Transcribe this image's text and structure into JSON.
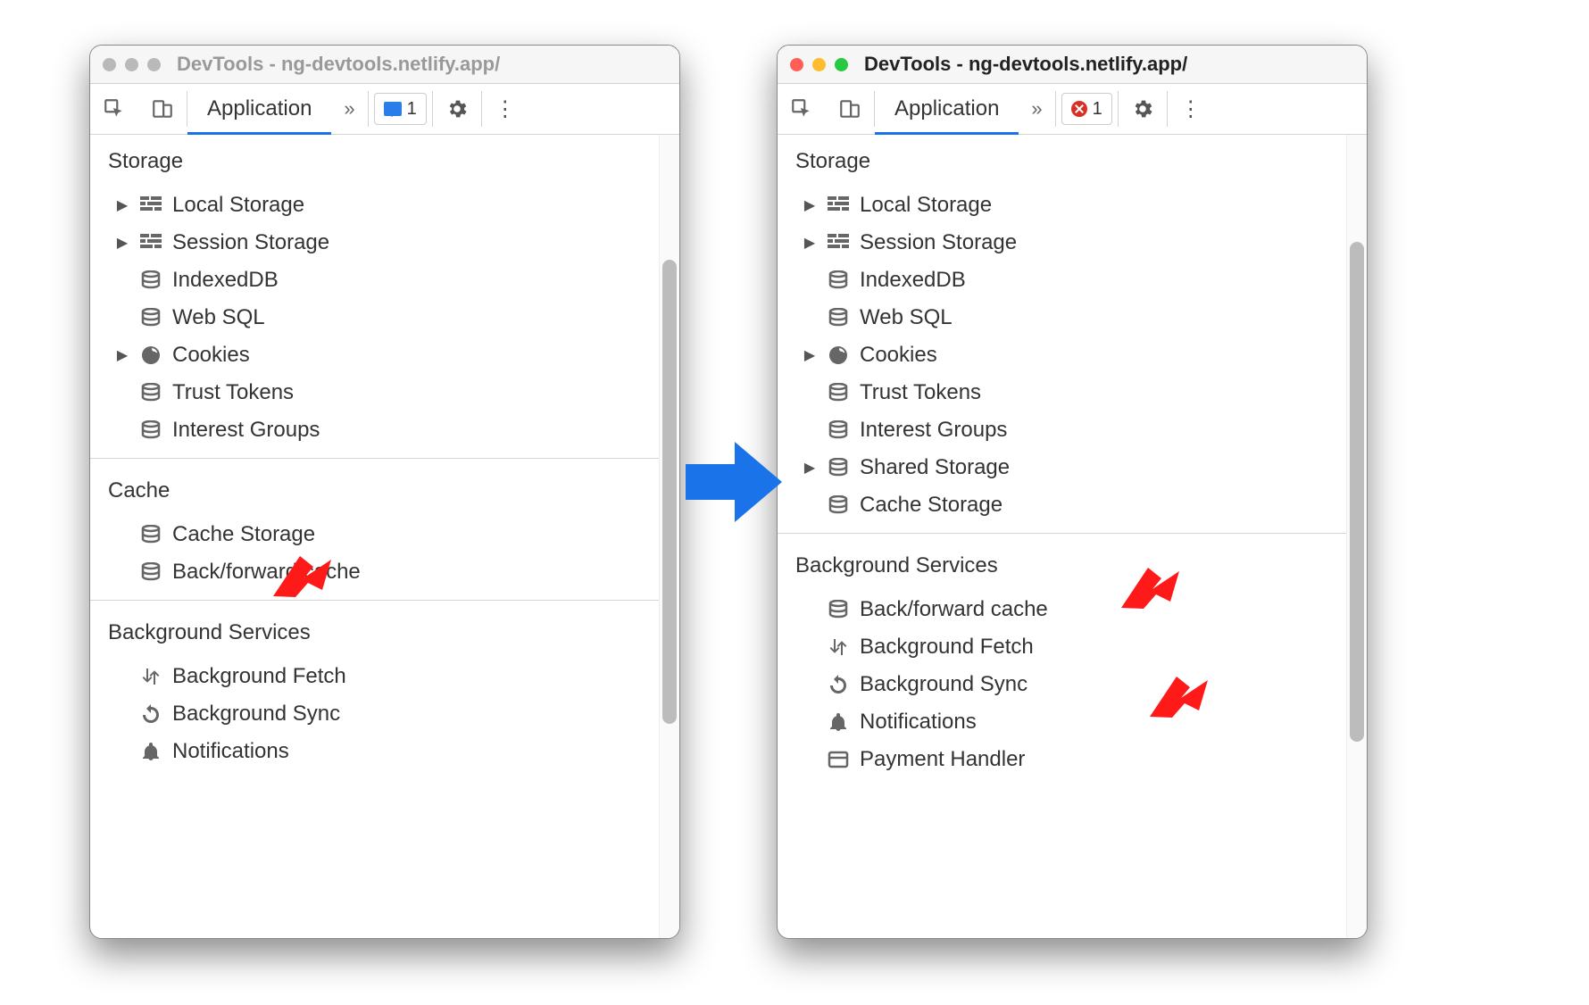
{
  "windows": {
    "left": {
      "title": "DevTools - ng-devtools.netlify.app/",
      "active": false,
      "toolbar": {
        "tab_label": "Application",
        "badge_count": "1",
        "badge_type": "message"
      },
      "sections": [
        {
          "title": "Storage",
          "items": [
            {
              "label": "Local Storage",
              "icon": "grid",
              "expandable": true
            },
            {
              "label": "Session Storage",
              "icon": "grid",
              "expandable": true
            },
            {
              "label": "IndexedDB",
              "icon": "db",
              "expandable": false
            },
            {
              "label": "Web SQL",
              "icon": "db",
              "expandable": false
            },
            {
              "label": "Cookies",
              "icon": "cookie",
              "expandable": true
            },
            {
              "label": "Trust Tokens",
              "icon": "db",
              "expandable": false
            },
            {
              "label": "Interest Groups",
              "icon": "db",
              "expandable": false
            }
          ]
        },
        {
          "title": "Cache",
          "items": [
            {
              "label": "Cache Storage",
              "icon": "db",
              "expandable": false
            },
            {
              "label": "Back/forward cache",
              "icon": "db",
              "expandable": false
            }
          ]
        },
        {
          "title": "Background Services",
          "items": [
            {
              "label": "Background Fetch",
              "icon": "fetch",
              "expandable": false
            },
            {
              "label": "Background Sync",
              "icon": "sync",
              "expandable": false
            },
            {
              "label": "Notifications",
              "icon": "bell",
              "expandable": false
            }
          ]
        }
      ]
    },
    "right": {
      "title": "DevTools - ng-devtools.netlify.app/",
      "active": true,
      "toolbar": {
        "tab_label": "Application",
        "badge_count": "1",
        "badge_type": "error"
      },
      "sections": [
        {
          "title": "Storage",
          "items": [
            {
              "label": "Local Storage",
              "icon": "grid",
              "expandable": true
            },
            {
              "label": "Session Storage",
              "icon": "grid",
              "expandable": true
            },
            {
              "label": "IndexedDB",
              "icon": "db",
              "expandable": false
            },
            {
              "label": "Web SQL",
              "icon": "db",
              "expandable": false
            },
            {
              "label": "Cookies",
              "icon": "cookie",
              "expandable": true
            },
            {
              "label": "Trust Tokens",
              "icon": "db",
              "expandable": false
            },
            {
              "label": "Interest Groups",
              "icon": "db",
              "expandable": false
            },
            {
              "label": "Shared Storage",
              "icon": "db",
              "expandable": true
            },
            {
              "label": "Cache Storage",
              "icon": "db",
              "expandable": false
            }
          ]
        },
        {
          "title": "Background Services",
          "items": [
            {
              "label": "Back/forward cache",
              "icon": "db",
              "expandable": false
            },
            {
              "label": "Background Fetch",
              "icon": "fetch",
              "expandable": false
            },
            {
              "label": "Background Sync",
              "icon": "sync",
              "expandable": false
            },
            {
              "label": "Notifications",
              "icon": "bell",
              "expandable": false
            },
            {
              "label": "Payment Handler",
              "icon": "card",
              "expandable": false
            }
          ]
        }
      ]
    }
  },
  "annotations": {
    "arrow_color": "#ff1a1a",
    "labels": [
      "Cache",
      "Cache Storage",
      "Back/forward cache"
    ]
  }
}
